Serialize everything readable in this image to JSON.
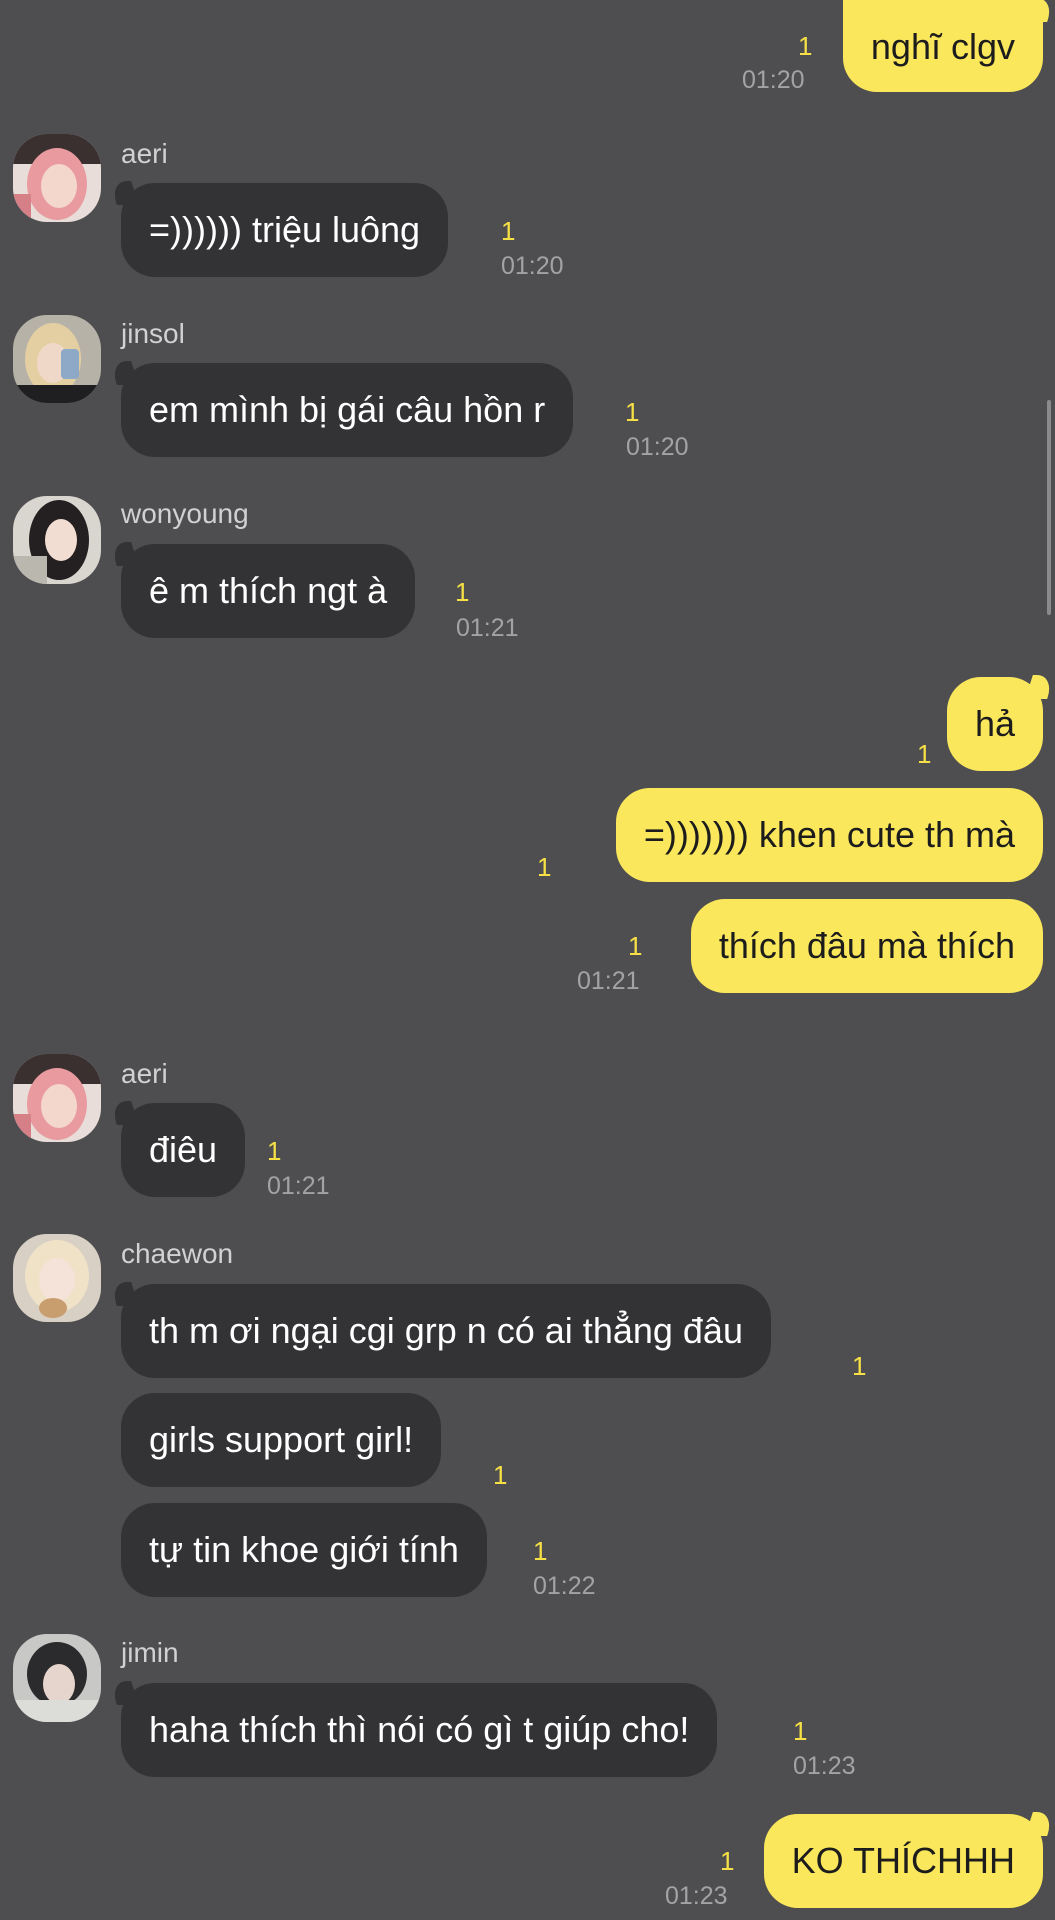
{
  "colors": {
    "background": "#4e4e50",
    "incoming_bubble": "#333335",
    "outgoing_bubble": "#fae75b",
    "read_count": "#f6e046",
    "timestamp": "#a3a3a6"
  },
  "messages": {
    "m1": {
      "text": "nghĩ clgv",
      "count": "1",
      "time": "01:20"
    },
    "g1": {
      "sender": "aeri",
      "m1": {
        "text": "=)))))) triệu luông",
        "count": "1",
        "time": "01:20"
      }
    },
    "g2": {
      "sender": "jinsol",
      "m1": {
        "text": "em mình bị gái câu hồn r",
        "count": "1",
        "time": "01:20"
      }
    },
    "g3": {
      "sender": "wonyoung",
      "m1": {
        "text": "ê m thích ngt à",
        "count": "1",
        "time": "01:21"
      }
    },
    "o2": {
      "text": "hả",
      "count": "1"
    },
    "o3": {
      "text": "=))))))) khen cute th mà",
      "count": "1"
    },
    "o4": {
      "text": "thích đâu mà thích",
      "count": "1",
      "time": "01:21"
    },
    "g4": {
      "sender": "aeri",
      "m1": {
        "text": "điêu",
        "count": "1",
        "time": "01:21"
      }
    },
    "g5": {
      "sender": "chaewon",
      "m1": {
        "text": "th m ơi ngại cgi grp n có ai thẳng đâu",
        "count": "1"
      },
      "m2": {
        "text": "girls support girl!",
        "count": "1"
      },
      "m3": {
        "text": "tự tin khoe giới tính",
        "count": "1",
        "time": "01:22"
      }
    },
    "g6": {
      "sender": "jimin",
      "m1": {
        "text": "haha thích thì nói có gì t giúp cho!",
        "count": "1",
        "time": "01:23"
      }
    },
    "o5": {
      "text": "KO THÍCHHH",
      "count": "1",
      "time": "01:23"
    }
  },
  "avatars": {
    "aeri": "avatar-aeri",
    "jinsol": "avatar-jinsol",
    "wonyoung": "avatar-wonyoung",
    "chaewon": "avatar-chaewon",
    "jimin": "avatar-jimin"
  }
}
